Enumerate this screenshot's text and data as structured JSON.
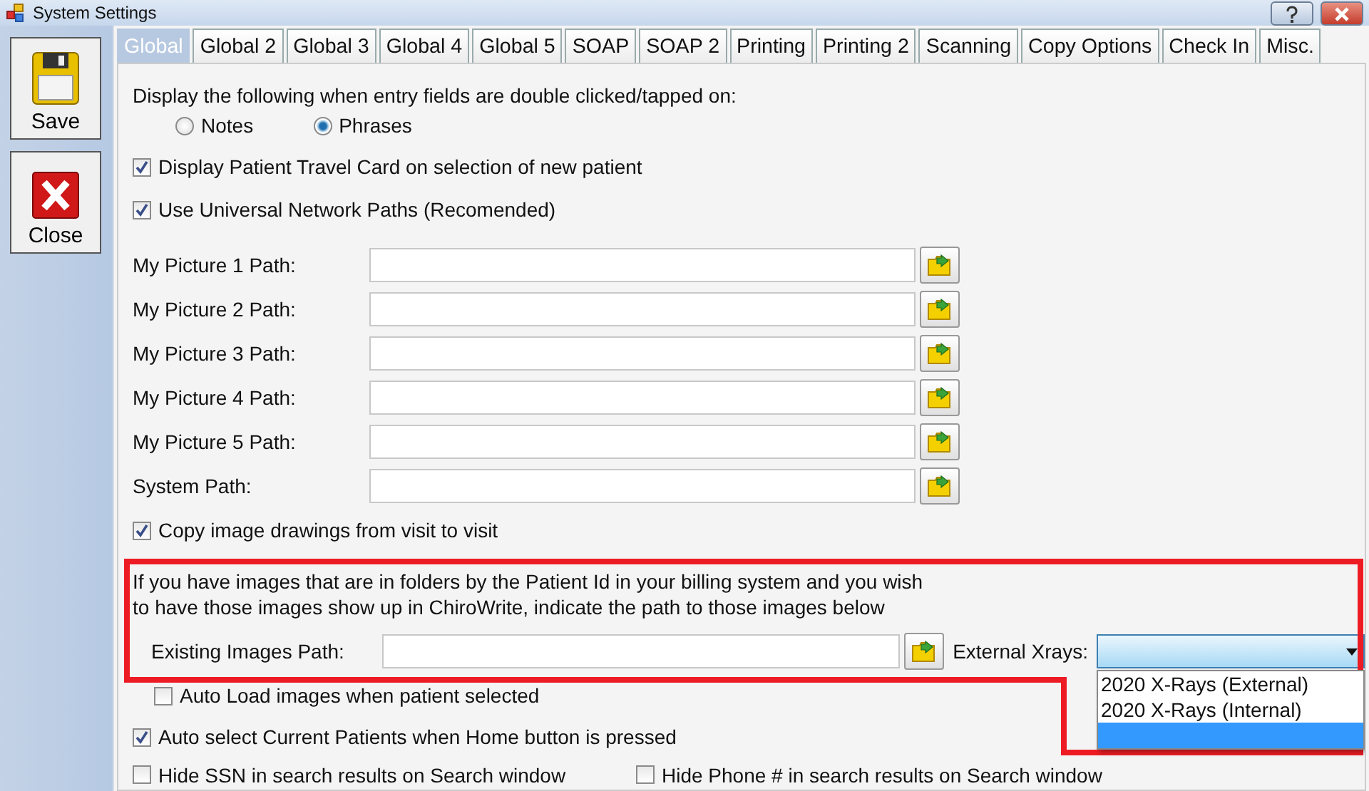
{
  "window": {
    "title": "System Settings"
  },
  "sidebar": {
    "buttons": [
      {
        "label": "Save",
        "kind": "save"
      },
      {
        "label": "Close",
        "kind": "close"
      }
    ]
  },
  "tabs": [
    {
      "label": "Global",
      "selected": true
    },
    {
      "label": "Global 2",
      "selected": false
    },
    {
      "label": "Global 3",
      "selected": false
    },
    {
      "label": "Global 4",
      "selected": false
    },
    {
      "label": "Global 5",
      "selected": false
    },
    {
      "label": "SOAP",
      "selected": false
    },
    {
      "label": "SOAP 2",
      "selected": false
    },
    {
      "label": "Printing",
      "selected": false
    },
    {
      "label": "Printing 2",
      "selected": false
    },
    {
      "label": "Scanning",
      "selected": false
    },
    {
      "label": "Copy Options",
      "selected": false
    },
    {
      "label": "Check In",
      "selected": false
    },
    {
      "label": "Misc.",
      "selected": false
    }
  ],
  "double_click": {
    "label": "Display the following when entry fields are double clicked/tapped on:",
    "options": [
      {
        "label": "Notes",
        "selected": false
      },
      {
        "label": "Phrases",
        "selected": true
      }
    ]
  },
  "top_checkboxes": [
    {
      "label": "Display Patient Travel Card on selection of new patient",
      "checked": true
    },
    {
      "label": "Use Universal Network Paths (Recomended)",
      "checked": true
    }
  ],
  "paths": [
    {
      "label": "My Picture 1 Path:"
    },
    {
      "label": "My Picture 2 Path:"
    },
    {
      "label": "My Picture 3 Path:"
    },
    {
      "label": "My Picture 4 Path:"
    },
    {
      "label": "My Picture 5 Path:"
    },
    {
      "label": "System Path:"
    }
  ],
  "copy_drawings": {
    "label": "Copy image drawings from visit to visit",
    "checked": true
  },
  "existing_images": {
    "note": [
      "If you have images that are in folders by the Patient Id in your billing system and you wish",
      "to have those images show up in ChiroWrite, indicate the path to those images below"
    ],
    "label": "Existing Images Path:",
    "xrays_label": "External Xrays:",
    "dropdown": {
      "expanded": true,
      "options": [
        {
          "label": "2020 X-Rays (External)",
          "selected": false
        },
        {
          "label": "2020 X-Rays (Internal)",
          "selected": false
        }
      ],
      "blank_option_selected": true
    }
  },
  "auto_load": {
    "label": "Auto Load images when patient selected",
    "checked": false
  },
  "auto_select": {
    "label": "Auto select Current Patients when Home button is pressed",
    "checked": true
  },
  "hide_options": [
    {
      "label": "Hide SSN in search results on Search window",
      "checked": false
    },
    {
      "label": "Hide Phone # in search results on Search window",
      "checked": false
    }
  ]
}
